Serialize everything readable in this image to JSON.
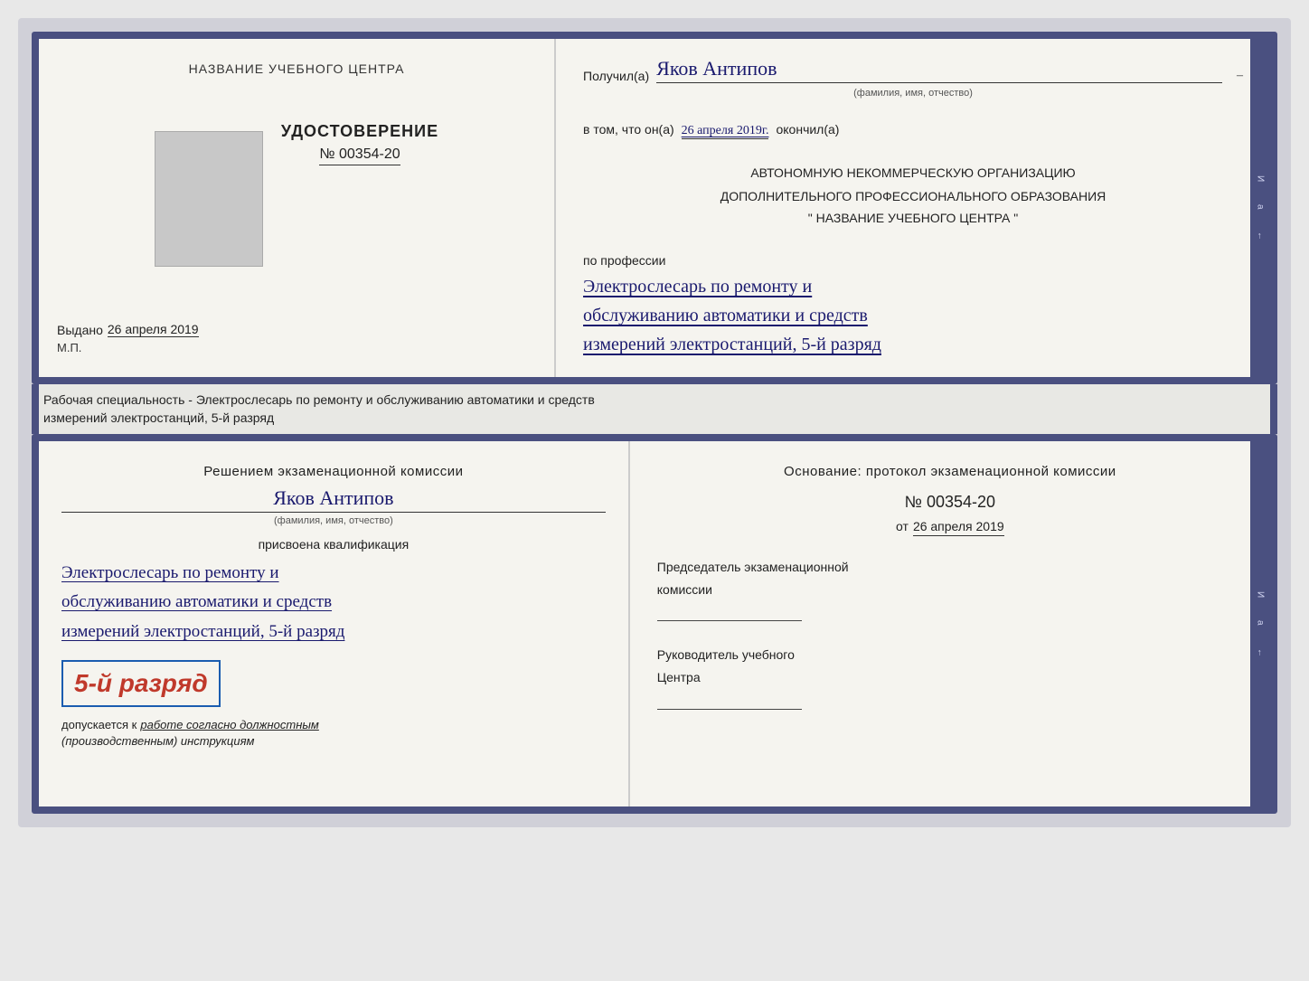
{
  "topDoc": {
    "left": {
      "schoolNameLabel": "НАЗВАНИЕ УЧЕБНОГО ЦЕНТРА",
      "certTitle": "УДОСТОВЕРЕНИЕ",
      "certNumber": "№ 00354-20",
      "issuedLabel": "Выдано",
      "issuedDate": "26 апреля 2019",
      "mpLabel": "М.П."
    },
    "right": {
      "recipientLabel": "Получил(а)",
      "recipientName": "Яков Антипов",
      "recipientSubtitle": "(фамилия, имя, отчество)",
      "vtomLabel": "в том, что он(а)",
      "vtomDate": "26 апреля 2019г.",
      "okonchilLabel": "окончил(а)",
      "orgLine1": "АВТОНОМНУЮ НЕКОММЕРЧЕСКУЮ ОРГАНИЗАЦИЮ",
      "orgLine2": "ДОПОЛНИТЕЛЬНОГО ПРОФЕССИОНАЛЬНОГО ОБРАЗОВАНИЯ",
      "orgName": "\"  НАЗВАНИЕ УЧЕБНОГО ЦЕНТРА  \"",
      "poProfessiiLabel": "по профессии",
      "profession1": "Электрослесарь по ремонту и",
      "profession2": "обслуживанию автоматики и средств",
      "profession3": "измерений электростанций, 5-й разряд"
    }
  },
  "separator": {
    "text": "Рабочая специальность - Электрослесарь по ремонту и обслуживанию автоматики и средств\nизмерений электростанций, 5-й разряд"
  },
  "bottomDoc": {
    "left": {
      "resheniemText": "Решением экзаменационной комиссии",
      "name": "Яков Антипов",
      "nameSubtitle": "(фамилия, имя, отчество)",
      "prisvoyenaText": "присвоена квалификация",
      "qual1": "Электрослесарь по ремонту и",
      "qual2": "обслуживанию автоматики и средств",
      "qual3": "измерений электростанций, 5-й разряд",
      "razryadBadge": "5-й разряд",
      "dopuskaetsyaLabel": "допускается к",
      "dopuskaetsyaText": "работе согласно должностным",
      "dopuskaetsyaText2": "(производственным) инструкциям"
    },
    "right": {
      "osnovanieTitleLine1": "Основание: протокол экзаменационной комиссии",
      "protocolNum": "№  00354-20",
      "otLabel": "от",
      "protocolDate": "26 апреля 2019",
      "chairmanLine1": "Председатель экзаменационной",
      "chairmanLine2": "комиссии",
      "rukovoditelLine1": "Руководитель учебного",
      "rukovoditelLine2": "Центра"
    }
  },
  "edgeDecorations": {
    "text1": "И",
    "text2": "а",
    "text3": "←"
  }
}
